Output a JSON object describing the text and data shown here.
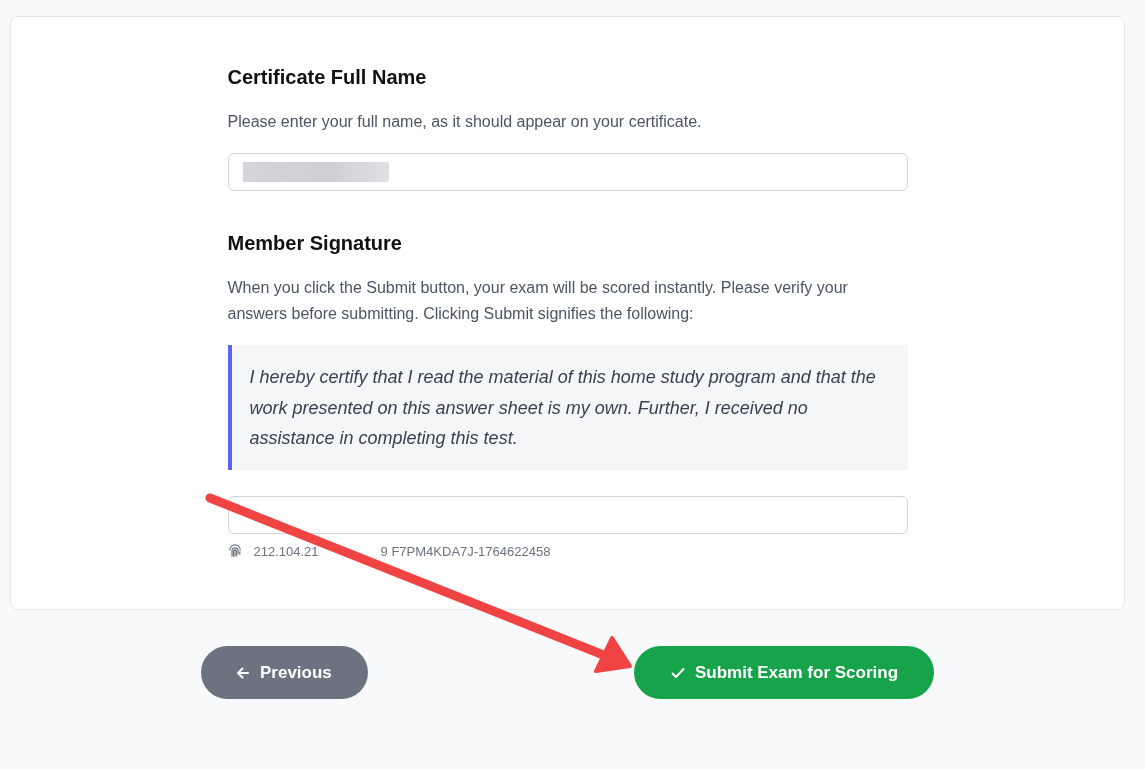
{
  "name_section": {
    "heading": "Certificate Full Name",
    "description": "Please enter your full name, as it should appear on your certificate.",
    "field": {
      "redacted": true
    }
  },
  "signature_section": {
    "heading": "Member Signature",
    "description": "When you click the Submit button, your exam will be scored instantly. Please verify your answers before submitting. Clicking Submit signifies the following:",
    "quote": "I hereby certify that I read the material of this home study program and that the work presented on this answer sheet is my own. Further, I received no assistance in completing this test.",
    "fingerprint_parts": [
      "212.104.21",
      "9 F7PM4KDA7J-1764622458"
    ]
  },
  "buttons": [
    {
      "kind": "previous",
      "label": "Previous"
    },
    {
      "kind": "submit",
      "label": "Submit Exam for Scoring"
    }
  ],
  "annotation": {
    "kind": "arrow"
  }
}
